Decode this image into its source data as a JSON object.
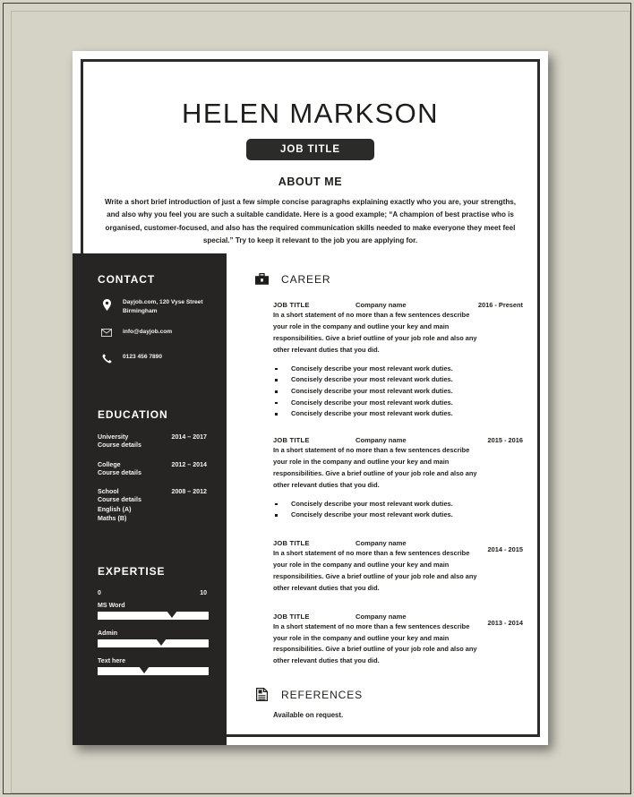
{
  "document": {
    "type": "resume-template",
    "colors": {
      "background": "#d5d3c6",
      "sidebar": "#262523",
      "page": "#ffffff",
      "text": "#1d1d1b",
      "accent": "#2b2b29"
    }
  },
  "header": {
    "name": "HELEN MARKSON",
    "job_title_badge": "JOB TITLE",
    "about_title": "ABOUT ME",
    "about_text": "Write a short brief introduction of just a few simple concise paragraphs explaining exactly who you are, your strengths, and also why you feel you are such a suitable candidate. Here is a good example; “A champion of best practise who is organised, customer-focused, and also has the required communication skills needed to make everyone they meet feel special.” Try to keep it relevant to the job you are applying for."
  },
  "sidebar": {
    "contact": {
      "heading": "CONTACT",
      "items": [
        {
          "icon": "location-pin-icon",
          "line1": "Dayjob.com, 120 Vyse Street",
          "line2": "Birmingham"
        },
        {
          "icon": "envelope-icon",
          "line1": "info@dayjob.com",
          "line2": ""
        },
        {
          "icon": "phone-icon",
          "line1": "0123 456 7890",
          "line2": ""
        }
      ]
    },
    "education": {
      "heading": "EDUCATION",
      "items": [
        {
          "institution": "University",
          "years": "2014 – 2017",
          "details": [
            "Course details"
          ]
        },
        {
          "institution": "College",
          "years": "2012 – 2014",
          "details": [
            "Course details"
          ]
        },
        {
          "institution": "School",
          "years": "2008 – 2012",
          "details": [
            "Course details",
            "English (A)",
            "Maths (B)"
          ]
        }
      ]
    },
    "expertise": {
      "heading": "EXPERTISE",
      "scale_min": "0",
      "scale_max": "10",
      "skills": [
        {
          "label": "MS Word",
          "value": 67
        },
        {
          "label": "Admin",
          "value": 57
        },
        {
          "label": "Text here",
          "value": 42
        }
      ]
    }
  },
  "main": {
    "career": {
      "icon": "briefcase-icon",
      "heading": "CAREER",
      "jobs": [
        {
          "title": "JOB TITLE",
          "company": "Company name",
          "date": "2016 - Present",
          "description": "In a short statement of no more than a few sentences describe your role in the company and outline your key and main responsibilities. Give a brief outline of your job role and also any other relevant duties that you did.",
          "bullets": [
            "Concisely describe your most relevant work duties.",
            "Concisely describe your most relevant work duties.",
            "Concisely describe your most relevant work duties.",
            "Concisely describe your most relevant work duties.",
            "Concisely describe your most relevant work duties."
          ]
        },
        {
          "title": "JOB TITLE",
          "company": "Company name",
          "date": "2015 - 2016",
          "description": "In a short statement of no more than a few sentences describe your role in the company and outline your key and main responsibilities. Give a brief outline of your job role and also any other relevant duties that you did.",
          "bullets": [
            "Concisely describe your most relevant work duties.",
            "Concisely describe your most relevant work duties."
          ]
        },
        {
          "title": "JOB TITLE",
          "company": "Company name",
          "date": "2014 - 2015",
          "description": "In a short statement of no more than a few sentences describe your role in the company and outline your key and main responsibilities. Give a brief outline of your job role and also any other relevant duties that you did.",
          "bullets": []
        },
        {
          "title": "JOB TITLE",
          "company": "Company name",
          "date": "2013 - 2014",
          "description": "In a short statement of no more than a few sentences describe your role in the company and outline your key and main responsibilities. Give a brief outline of your job role and also any other relevant duties that you did.",
          "bullets": []
        }
      ]
    },
    "references": {
      "icon": "document-icon",
      "heading": "REFERENCES",
      "text": "Available on request."
    }
  }
}
